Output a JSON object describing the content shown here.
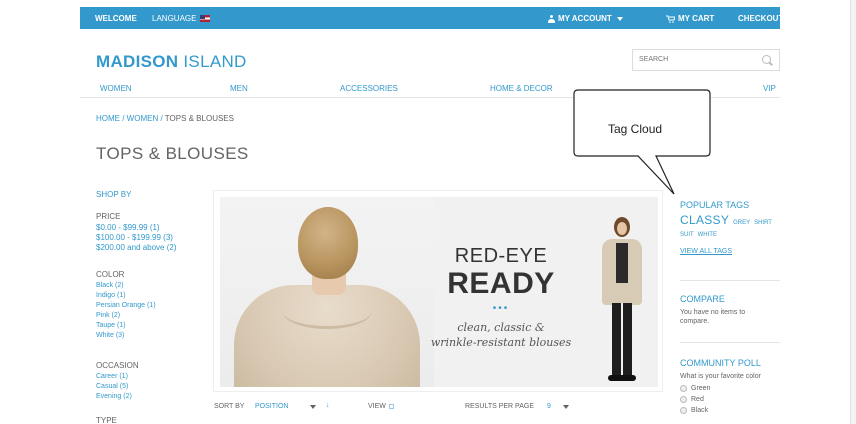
{
  "topbar": {
    "welcome": "WELCOME",
    "language": "LANGUAGE",
    "my_account": "MY ACCOUNT",
    "my_cart": "MY CART",
    "checkout": "CHECKOUT",
    "bg_color": "#3399cc"
  },
  "header": {
    "logo_bold": "MADISON",
    "logo_light": " ISLAND",
    "search_placeholder": "SEARCH"
  },
  "nav": {
    "items": [
      "WOMEN",
      "MEN",
      "ACCESSORIES",
      "HOME & DECOR",
      "VIP"
    ]
  },
  "breadcrumb": {
    "home": "HOME",
    "women": "WOMEN",
    "current": "TOPS & BLOUSES",
    "sep": " / "
  },
  "page_title": "TOPS & BLOUSES",
  "sidebar": {
    "shop_by": "SHOP BY",
    "price": {
      "heading": "PRICE",
      "items": [
        "$0.00 - $99.99 (1)",
        "$100.00 - $199.99 (3)",
        "$200.00 and above (2)"
      ]
    },
    "color": {
      "heading": "COLOR",
      "items": [
        "Black (2)",
        "Indigo (1)",
        "Persian Orange (1)",
        "Pink (2)",
        "Taupe (1)",
        "White (3)"
      ]
    },
    "occasion": {
      "heading": "OCCASION",
      "items": [
        "Career (1)",
        "Casual (5)",
        "Evening (2)"
      ]
    },
    "type_heading": "TYPE"
  },
  "banner": {
    "headline1": "RED-EYE",
    "headline2": "READY",
    "dots": "•••",
    "tagline1": "clean, classic &",
    "tagline2": "wrinkle-resistant blouses"
  },
  "toolbar": {
    "sort_by": "SORT BY",
    "sort_value": "POSITION",
    "view": "VIEW",
    "results_per_page": "RESULTS PER PAGE",
    "results_value": "9"
  },
  "right": {
    "popular_tags": "POPULAR TAGS",
    "tag_classy": "CLASSY",
    "tag_grey": "GREY",
    "tag_shirt": "SHIRT",
    "tag_suit": "SUIT",
    "tag_white": "WHITE",
    "view_all_tags": "VIEW ALL TAGS",
    "compare": "COMPARE",
    "compare_text": "You have no items to compare.",
    "community_poll": "COMMUNITY POLL",
    "poll_question": "What is your favorite color",
    "poll_options": [
      "Green",
      "Red",
      "Black"
    ]
  },
  "callout": {
    "label": "Tag Cloud"
  },
  "colors": {
    "accent": "#3399cc",
    "text": "#636363"
  }
}
